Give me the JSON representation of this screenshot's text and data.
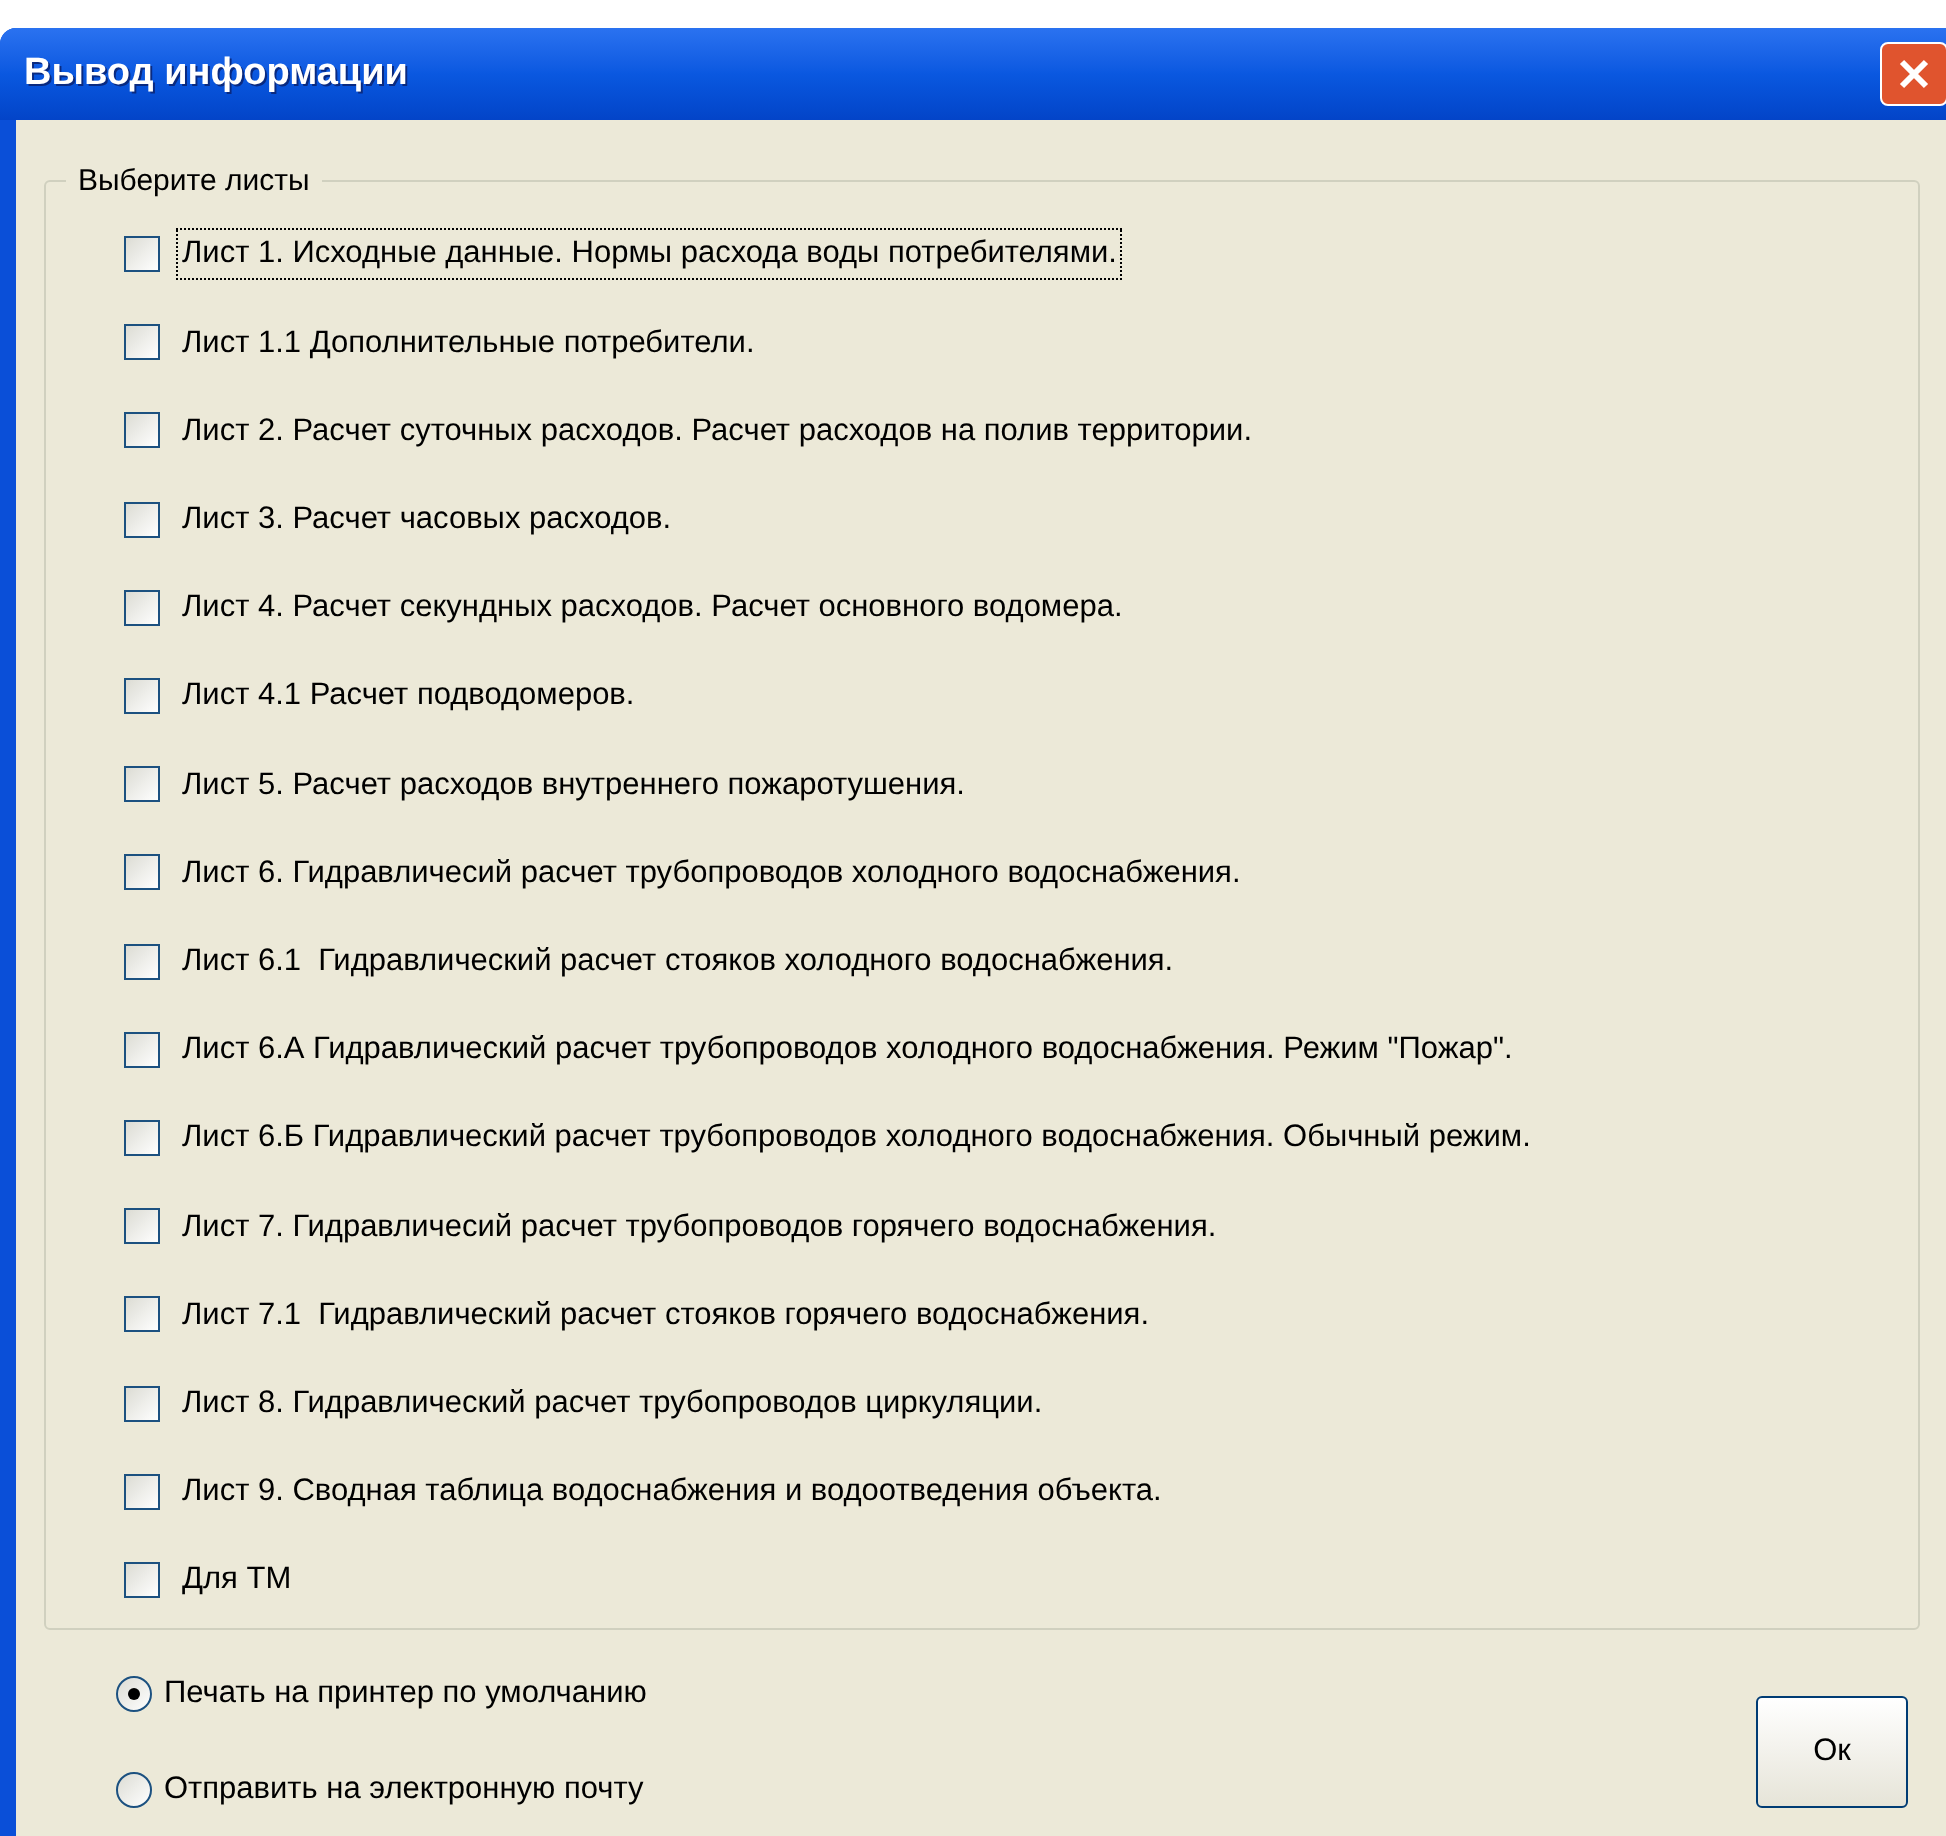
{
  "window": {
    "title": "Вывод информации"
  },
  "group": {
    "title": "Выберите листы",
    "items": [
      {
        "label": "Лист 1. Исходные данные. Нормы расхода воды потребителями.",
        "checked": false,
        "focused": true
      },
      {
        "label": "Лист 1.1 Дополнительные потребители.",
        "checked": false,
        "focused": false
      },
      {
        "label": "Лист 2. Расчет суточных расходов. Расчет расходов на полив территории.",
        "checked": false,
        "focused": false
      },
      {
        "label": "Лист 3. Расчет часовых расходов.",
        "checked": false,
        "focused": false
      },
      {
        "label": "Лист 4. Расчет секундных расходов. Расчет основного водомера.",
        "checked": false,
        "focused": false
      },
      {
        "label": "Лист 4.1 Расчет подводомеров.",
        "checked": false,
        "focused": false
      },
      {
        "label": "Лист 5. Расчет расходов внутреннего пожаротушения.",
        "checked": false,
        "focused": false
      },
      {
        "label": "Лист 6. Гидравличесий расчет трубопроводов холодного водоснабжения.",
        "checked": false,
        "focused": false
      },
      {
        "label": "Лист 6.1  Гидравлический расчет стояков холодного водоснабжения.",
        "checked": false,
        "focused": false
      },
      {
        "label": "Лист 6.А Гидравлический расчет трубопроводов холодного водоснабжения. Режим \"Пожар\".",
        "checked": false,
        "focused": false
      },
      {
        "label": "Лист 6.Б Гидравлический расчет трубопроводов холодного водоснабжения. Обычный режим.",
        "checked": false,
        "focused": false
      },
      {
        "label": "Лист 7. Гидравличесий расчет трубопроводов горячего водоснабжения.",
        "checked": false,
        "focused": false
      },
      {
        "label": "Лист 7.1  Гидравлический расчет стояков горячего водоснабжения.",
        "checked": false,
        "focused": false
      },
      {
        "label": "Лист 8. Гидравлический расчет трубопроводов циркуляции.",
        "checked": false,
        "focused": false
      },
      {
        "label": "Лист 9. Сводная таблица водоснабжения и водоотведения объекта.",
        "checked": false,
        "focused": false
      },
      {
        "label": "Для ТМ",
        "checked": false,
        "focused": false
      }
    ]
  },
  "output_options": [
    {
      "label": "Печать на принтер по умолчанию",
      "selected": true
    },
    {
      "label": "Отправить на электронную почту",
      "selected": false
    }
  ],
  "buttons": [
    {
      "label": "Ок"
    }
  ]
}
